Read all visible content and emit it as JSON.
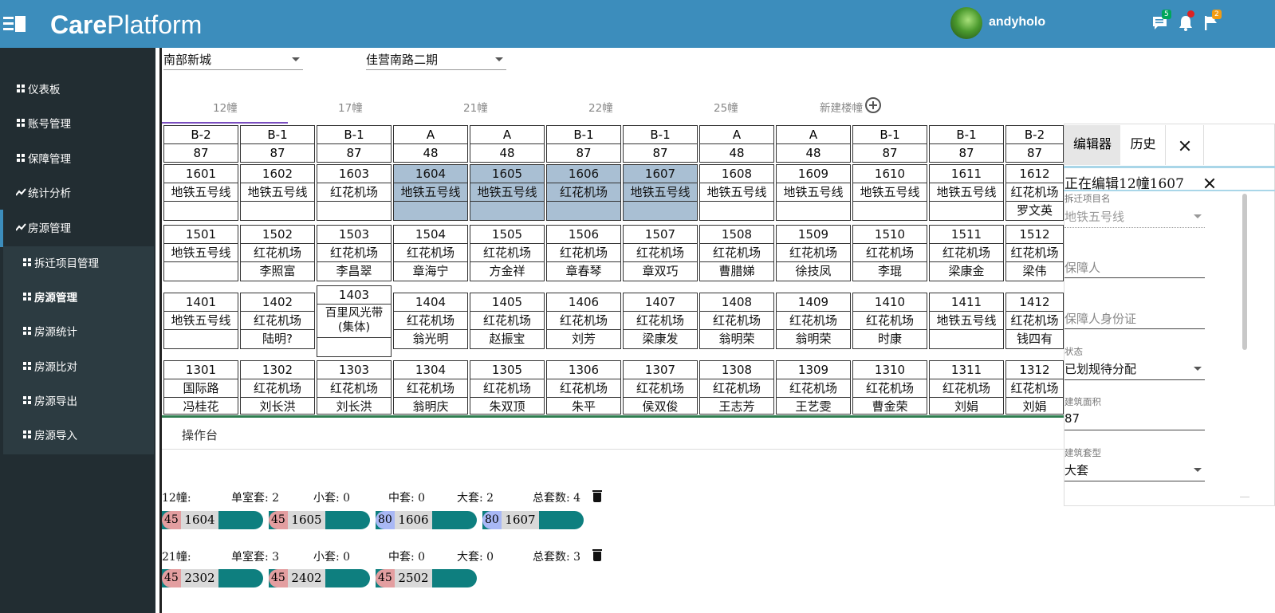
{
  "header": {
    "brand_bold": "Care",
    "brand_rest": "Platform",
    "username": "andyholo",
    "messages_badge": "5",
    "flags_badge": "2",
    "accent": "#3c8dbc"
  },
  "sidebar": {
    "items": [
      {
        "label": "仪表板",
        "icon": "dashboard-icon"
      },
      {
        "label": "账号管理",
        "icon": "dashboard-icon"
      },
      {
        "label": "保障管理",
        "icon": "dashboard-icon"
      },
      {
        "label": "统计分析",
        "icon": "line-chart-icon"
      },
      {
        "label": "房源管理",
        "icon": "line-chart-icon"
      }
    ],
    "subitems": [
      {
        "label": "拆迁项目管理"
      },
      {
        "label": "房源管理"
      },
      {
        "label": "房源统计"
      },
      {
        "label": "房源比对"
      },
      {
        "label": "房源导出"
      },
      {
        "label": "房源导入"
      }
    ]
  },
  "filters": {
    "district": "南部新城",
    "project": "佳营南路二期"
  },
  "building_tabs": [
    "12幢",
    "17幢",
    "21幢",
    "22幢",
    "25幢"
  ],
  "new_building_label": "新建楼幢",
  "grid": {
    "header_types": [
      "B-2",
      "B-1",
      "B-1",
      "A",
      "A",
      "B-1",
      "B-1",
      "A",
      "A",
      "B-1",
      "B-1",
      "B-2"
    ],
    "header_areas": [
      "87",
      "87",
      "87",
      "48",
      "48",
      "87",
      "87",
      "48",
      "48",
      "87",
      "87",
      "87"
    ],
    "row16": [
      [
        "1601",
        "地铁五号线",
        ""
      ],
      [
        "1602",
        "地铁五号线",
        ""
      ],
      [
        "1603",
        "红花机场",
        ""
      ],
      [
        "1604",
        "地铁五号线",
        ""
      ],
      [
        "1605",
        "地铁五号线",
        ""
      ],
      [
        "1606",
        "红花机场",
        ""
      ],
      [
        "1607",
        "地铁五号线",
        ""
      ],
      [
        "1608",
        "地铁五号线",
        ""
      ],
      [
        "1609",
        "地铁五号线",
        ""
      ],
      [
        "1610",
        "地铁五号线",
        ""
      ],
      [
        "1611",
        "地铁五号线",
        ""
      ],
      [
        "1612",
        "红花机场",
        "罗文英"
      ]
    ],
    "row15": [
      [
        "1501",
        "地铁五号线",
        ""
      ],
      [
        "1502",
        "红花机场",
        "李照富"
      ],
      [
        "1503",
        "红花机场",
        "李昌翠"
      ],
      [
        "1504",
        "红花机场",
        "章海宁"
      ],
      [
        "1505",
        "红花机场",
        "方金祥"
      ],
      [
        "1506",
        "红花机场",
        "章春琴"
      ],
      [
        "1507",
        "红花机场",
        "章双巧"
      ],
      [
        "1508",
        "红花机场",
        "曹腊娣"
      ],
      [
        "1509",
        "红花机场",
        "徐技凤"
      ],
      [
        "1510",
        "红花机场",
        "李琨"
      ],
      [
        "1511",
        "红花机场",
        "梁康金"
      ],
      [
        "1512",
        "红花机场",
        "梁伟"
      ]
    ],
    "row14": [
      [
        "1401",
        "地铁五号线",
        ""
      ],
      [
        "1402",
        "红花机场",
        "陆明?"
      ],
      [
        "1403",
        "百里风光带(集体)",
        ""
      ],
      [
        "1404",
        "红花机场",
        "翁光明"
      ],
      [
        "1405",
        "红花机场",
        "赵振宝"
      ],
      [
        "1406",
        "红花机场",
        "刘芳"
      ],
      [
        "1407",
        "红花机场",
        "梁康发"
      ],
      [
        "1408",
        "红花机场",
        "翁明荣"
      ],
      [
        "1409",
        "红花机场",
        "翁明荣"
      ],
      [
        "1410",
        "红花机场",
        "时康"
      ],
      [
        "1411",
        "地铁五号线",
        ""
      ],
      [
        "1412",
        "红花机场",
        "钱四有"
      ]
    ],
    "row13": [
      [
        "1301",
        "国际路",
        "冯桂花"
      ],
      [
        "1302",
        "红花机场",
        "刘长洪"
      ],
      [
        "1303",
        "红花机场",
        "刘长洪"
      ],
      [
        "1304",
        "红花机场",
        "翁明庆"
      ],
      [
        "1305",
        "红花机场",
        "朱双顶"
      ],
      [
        "1306",
        "红花机场",
        "朱平"
      ],
      [
        "1307",
        "红花机场",
        "侯双俊"
      ],
      [
        "1308",
        "红花机场",
        "王志芳"
      ],
      [
        "1309",
        "红花机场",
        "王艺雯"
      ],
      [
        "1310",
        "红花机场",
        "曹金荣"
      ],
      [
        "1311",
        "红花机场",
        "刘娟"
      ],
      [
        "1312",
        "红花机场",
        "刘娟"
      ]
    ],
    "selected": [
      "1604",
      "1605",
      "1606",
      "1607"
    ]
  },
  "console": {
    "label": "操作台",
    "groups": [
      {
        "building": "12幢:",
        "single": "单室套: 2",
        "small": "小套: 0",
        "medium": "中套: 0",
        "large": "大套:  2",
        "total": "总套数: 4",
        "chips": [
          {
            "area": "45",
            "no": "1604",
            "color": "#e39ea0"
          },
          {
            "area": "45",
            "no": "1605",
            "color": "#e39ea0"
          },
          {
            "area": "80",
            "no": "1606",
            "color": "#a9b8f5"
          },
          {
            "area": "80",
            "no": "1607",
            "color": "#a9b8f5"
          }
        ]
      },
      {
        "building": "21幢:",
        "single": "单室套: 3",
        "small": "小套: 0",
        "medium": "中套: 0",
        "large": "大套:  0",
        "total": "总套数: 3",
        "chips": [
          {
            "area": "45",
            "no": "2302",
            "color": "#e39ea0"
          },
          {
            "area": "45",
            "no": "2402",
            "color": "#e39ea0"
          },
          {
            "area": "45",
            "no": "2502",
            "color": "#e39ea0"
          }
        ]
      }
    ]
  },
  "editor": {
    "tab_editor": "编辑器",
    "tab_history": "历史",
    "editing_title": "正在编辑12幢1607",
    "project_label": "拆迁项目名",
    "project_value": "地铁五号线",
    "guarantor_placeholder": "保障人",
    "guarantor_id_placeholder": "保障人身份证",
    "status_label": "状态",
    "status_value": "已划规待分配",
    "area_label": "建筑面积",
    "area_value": "87",
    "type_label": "建筑套型",
    "type_value": "大套"
  }
}
